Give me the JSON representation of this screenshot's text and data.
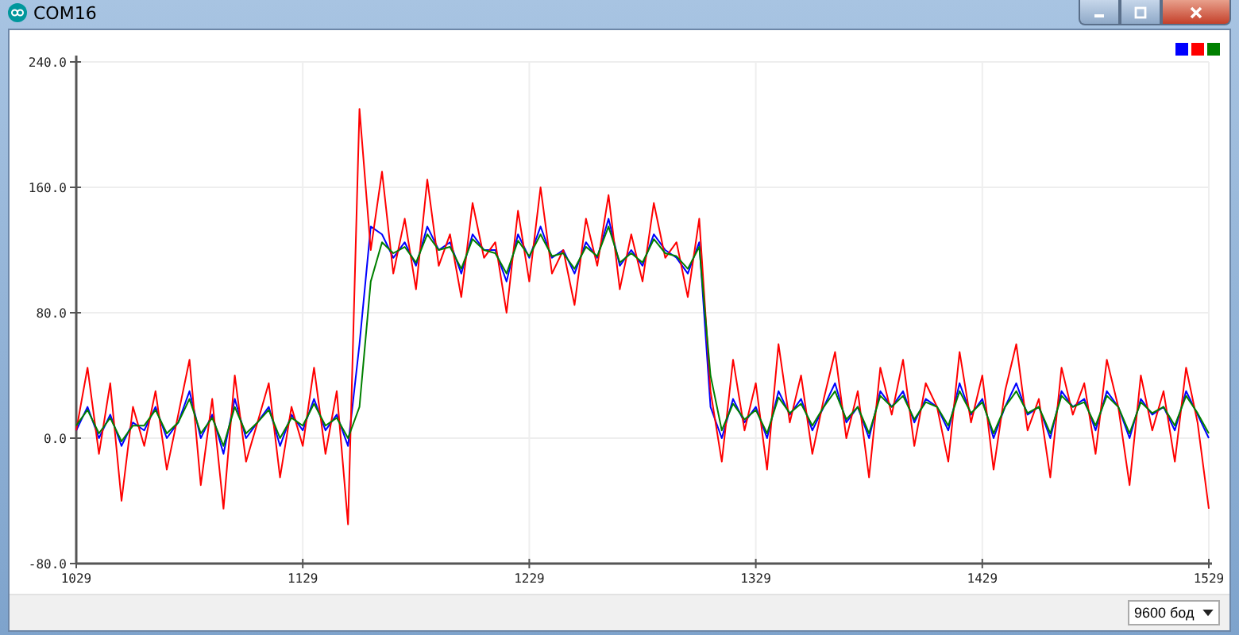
{
  "window": {
    "title": "COM16"
  },
  "plot": {
    "chart_data": {
      "type": "line",
      "grid": true,
      "xlim": [
        1029,
        1529
      ],
      "ylim": [
        -80,
        240
      ],
      "xticks": [
        1029,
        1129,
        1229,
        1329,
        1429,
        1529
      ],
      "yticks": [
        {
          "value": -80,
          "label": "-80.0"
        },
        {
          "value": 0,
          "label": "0.0"
        },
        {
          "value": 80,
          "label": "80.0"
        },
        {
          "value": 160,
          "label": "160.0"
        },
        {
          "value": 240,
          "label": "240.0"
        }
      ],
      "x": [
        1029,
        1034,
        1039,
        1044,
        1049,
        1054,
        1059,
        1064,
        1069,
        1074,
        1079,
        1084,
        1089,
        1094,
        1099,
        1104,
        1109,
        1114,
        1119,
        1124,
        1129,
        1134,
        1139,
        1144,
        1149,
        1154,
        1159,
        1164,
        1169,
        1174,
        1179,
        1184,
        1189,
        1194,
        1199,
        1204,
        1209,
        1214,
        1219,
        1224,
        1229,
        1234,
        1239,
        1244,
        1249,
        1254,
        1259,
        1264,
        1269,
        1274,
        1279,
        1284,
        1289,
        1294,
        1299,
        1304,
        1309,
        1314,
        1319,
        1324,
        1329,
        1334,
        1339,
        1344,
        1349,
        1354,
        1359,
        1364,
        1369,
        1374,
        1379,
        1384,
        1389,
        1394,
        1399,
        1404,
        1409,
        1414,
        1419,
        1424,
        1429,
        1434,
        1439,
        1444,
        1449,
        1454,
        1459,
        1464,
        1469,
        1474,
        1479,
        1484,
        1489,
        1494,
        1499,
        1504,
        1509,
        1514,
        1519,
        1524,
        1529
      ],
      "series": [
        {
          "color": "#0000ff",
          "values": [
            5,
            20,
            0,
            15,
            -5,
            10,
            5,
            20,
            0,
            10,
            30,
            0,
            15,
            -10,
            25,
            0,
            10,
            20,
            -5,
            15,
            5,
            25,
            5,
            15,
            -5,
            60,
            135,
            130,
            115,
            125,
            110,
            135,
            120,
            125,
            105,
            130,
            120,
            120,
            100,
            130,
            115,
            135,
            115,
            120,
            105,
            125,
            115,
            140,
            110,
            120,
            110,
            130,
            120,
            115,
            105,
            125,
            20,
            0,
            25,
            10,
            20,
            0,
            30,
            15,
            25,
            5,
            20,
            35,
            10,
            20,
            0,
            30,
            20,
            30,
            10,
            25,
            20,
            5,
            35,
            15,
            25,
            0,
            20,
            35,
            15,
            20,
            0,
            30,
            20,
            25,
            5,
            30,
            20,
            0,
            25,
            15,
            20,
            5,
            30,
            15,
            0
          ]
        },
        {
          "color": "#ff0000",
          "values": [
            5,
            45,
            -10,
            35,
            -40,
            20,
            -5,
            30,
            -20,
            15,
            50,
            -30,
            25,
            -45,
            40,
            -15,
            10,
            35,
            -25,
            20,
            -5,
            45,
            -10,
            30,
            -55,
            210,
            120,
            170,
            105,
            140,
            95,
            165,
            110,
            130,
            90,
            150,
            115,
            125,
            80,
            145,
            100,
            160,
            105,
            120,
            85,
            140,
            110,
            155,
            95,
            130,
            100,
            150,
            115,
            125,
            90,
            140,
            30,
            -15,
            50,
            5,
            35,
            -20,
            60,
            10,
            40,
            -10,
            25,
            55,
            0,
            30,
            -25,
            45,
            15,
            50,
            -5,
            35,
            20,
            -15,
            55,
            10,
            40,
            -20,
            30,
            60,
            5,
            25,
            -25,
            45,
            15,
            35,
            -10,
            50,
            20,
            -30,
            40,
            5,
            30,
            -15,
            45,
            10,
            -45
          ]
        },
        {
          "color": "#008000",
          "values": [
            8,
            18,
            3,
            13,
            -2,
            8,
            8,
            18,
            3,
            10,
            25,
            3,
            13,
            -5,
            20,
            3,
            10,
            18,
            0,
            13,
            8,
            22,
            8,
            13,
            0,
            20,
            100,
            125,
            118,
            122,
            112,
            130,
            120,
            122,
            108,
            127,
            120,
            118,
            105,
            126,
            116,
            130,
            116,
            118,
            108,
            122,
            116,
            135,
            112,
            118,
            112,
            127,
            118,
            116,
            108,
            122,
            40,
            5,
            22,
            12,
            18,
            3,
            26,
            16,
            22,
            8,
            20,
            30,
            12,
            20,
            3,
            27,
            20,
            27,
            12,
            23,
            20,
            8,
            30,
            16,
            23,
            3,
            20,
            30,
            16,
            20,
            3,
            27,
            20,
            23,
            8,
            27,
            20,
            3,
            23,
            16,
            20,
            8,
            27,
            16,
            3
          ]
        }
      ]
    }
  },
  "baud_select": {
    "value": "9600 бод"
  }
}
